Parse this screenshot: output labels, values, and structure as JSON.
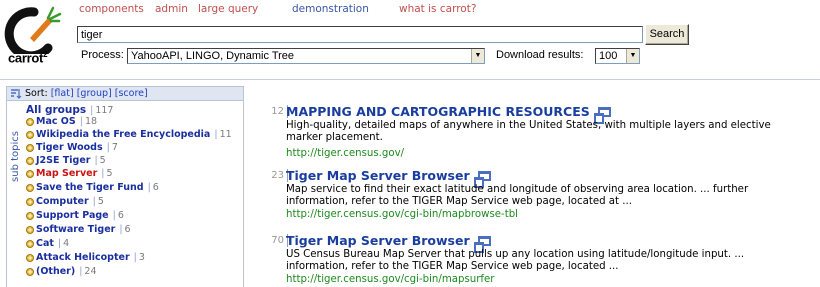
{
  "app": {
    "brand": "carrot",
    "brand_sup": "2"
  },
  "topnav": [
    {
      "label": "components",
      "color": "#c0504d"
    },
    {
      "label": "admin",
      "color": "#c0504d"
    },
    {
      "label": "large query",
      "color": "#c0504d"
    },
    {
      "label": "demonstration",
      "color": "#3a57a8"
    },
    {
      "label": "what is carrot?",
      "color": "#c0504d"
    }
  ],
  "search": {
    "query": "tiger",
    "button_label": "Search"
  },
  "process": {
    "label": "Process:",
    "value": "YahooAPI, LINGO, Dynamic Tree"
  },
  "download": {
    "label": "Download results:",
    "value": "100"
  },
  "sidebar": {
    "sort_prefix": "Sort:",
    "sort_flat": "[flat]",
    "sort_group": "[group]",
    "sort_score": "[score]",
    "tab_label": "sub topics",
    "all_groups": {
      "label": "All groups",
      "count": "117"
    },
    "clusters": [
      {
        "label": "Mac OS",
        "count": "18",
        "active": false
      },
      {
        "label": "Wikipedia the Free Encyclopedia",
        "count": "11",
        "active": false
      },
      {
        "label": "Tiger Woods",
        "count": "7",
        "active": false
      },
      {
        "label": "J2SE Tiger",
        "count": "5",
        "active": false
      },
      {
        "label": "Map Server",
        "count": "5",
        "active": true
      },
      {
        "label": "Save the Tiger Fund",
        "count": "6",
        "active": false
      },
      {
        "label": "Computer",
        "count": "5",
        "active": false
      },
      {
        "label": "Support Page",
        "count": "6",
        "active": false
      },
      {
        "label": "Software Tiger",
        "count": "6",
        "active": false
      },
      {
        "label": "Cat",
        "count": "4",
        "active": false
      },
      {
        "label": "Attack Helicopter",
        "count": "3",
        "active": false
      },
      {
        "label": "(Other)",
        "count": "24",
        "active": false
      }
    ]
  },
  "results": [
    {
      "rank": "12",
      "title": "MAPPING AND CARTOGRAPHIC RESOURCES",
      "snippet": "High-quality, detailed maps of anywhere in the United States, with multiple layers and elective marker placement.",
      "url": "http://tiger.census.gov/"
    },
    {
      "rank": "23",
      "title": "Tiger Map Server Browser",
      "snippet": "Map service to find their exact latitude and longitude of observing area location. ... further information, refer to the TIGER Map Service web page, located at ...",
      "url": "http://tiger.census.gov/cgi-bin/mapbrowse-tbl"
    },
    {
      "rank": "70",
      "title": "Tiger Map Server Browser",
      "snippet": "US Census Bureau Map Server that pulls up any location using latitude/longitude input. ... information, refer to the TIGER Map Service web page, located ...",
      "url": "http://tiger.census.gov/cgi-bin/mapsurfer"
    }
  ]
}
